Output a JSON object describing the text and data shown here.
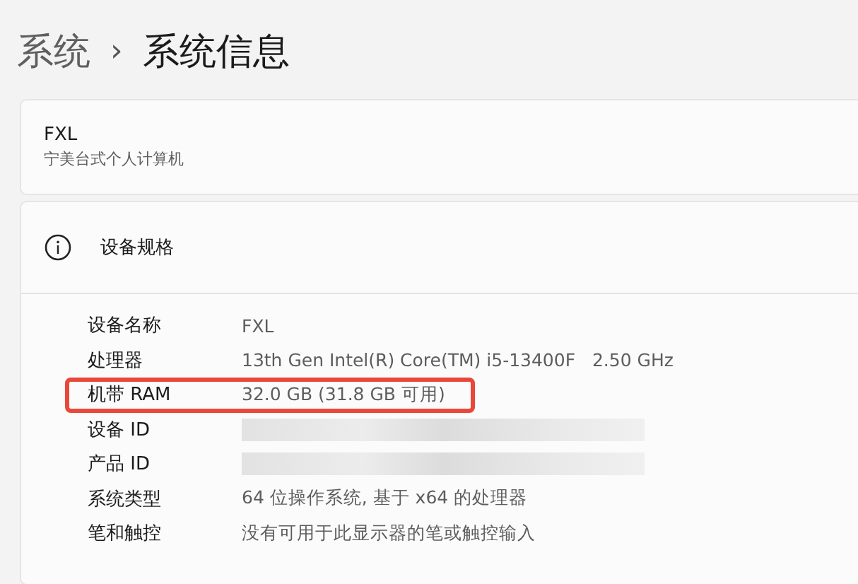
{
  "breadcrumb": {
    "parent": "系统",
    "separator": "›",
    "current": "系统信息"
  },
  "device": {
    "name": "FXL",
    "model": "宁美台式个人计算机"
  },
  "specs": {
    "title": "设备规格",
    "rows": [
      {
        "label": "设备名称",
        "value": "FXL"
      },
      {
        "label": "处理器",
        "value": "13th Gen Intel(R) Core(TM) i5-13400F   2.50 GHz"
      },
      {
        "label": "机带 RAM",
        "value": "32.0 GB (31.8 GB 可用)",
        "highlighted": true
      },
      {
        "label": "设备 ID",
        "redacted": true
      },
      {
        "label": "产品 ID",
        "redacted": true
      },
      {
        "label": "系统类型",
        "value": "64 位操作系统, 基于 x64 的处理器"
      },
      {
        "label": "笔和触控",
        "value": "没有可用于此显示器的笔或触控输入"
      }
    ]
  }
}
